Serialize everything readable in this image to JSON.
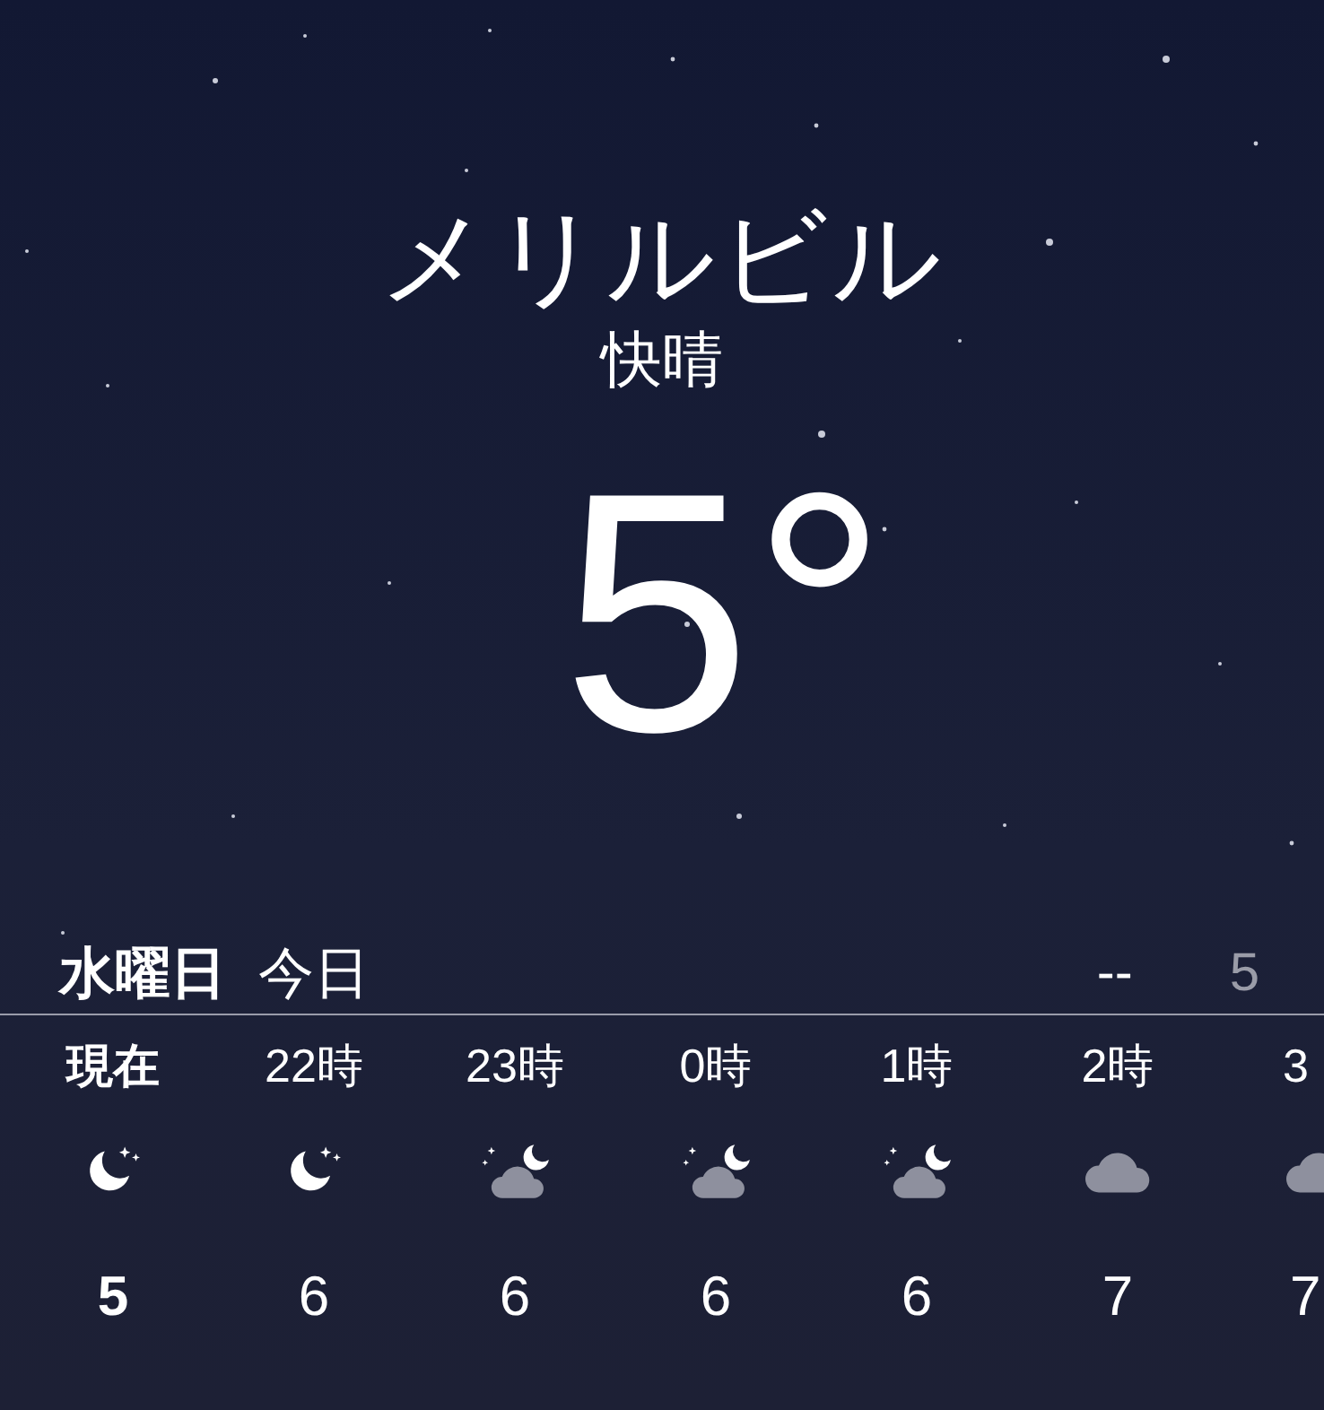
{
  "location": {
    "city": "メリルビル",
    "condition": "快晴",
    "temperature": "5°"
  },
  "today": {
    "weekday": "水曜日",
    "label": "今日",
    "high": "--",
    "low": "5"
  },
  "hours": [
    {
      "time": "現在",
      "kind": "clear-night",
      "temp": "5",
      "now": true
    },
    {
      "time": "22時",
      "kind": "clear-night",
      "temp": "6",
      "now": false
    },
    {
      "time": "23時",
      "kind": "partly-cloudy-night",
      "temp": "6",
      "now": false
    },
    {
      "time": "0時",
      "kind": "partly-cloudy-night",
      "temp": "6",
      "now": false
    },
    {
      "time": "1時",
      "kind": "partly-cloudy-night",
      "temp": "6",
      "now": false
    },
    {
      "time": "2時",
      "kind": "cloudy",
      "temp": "7",
      "now": false
    },
    {
      "time": "3",
      "kind": "cloudy",
      "temp": "7",
      "now": false
    }
  ]
}
